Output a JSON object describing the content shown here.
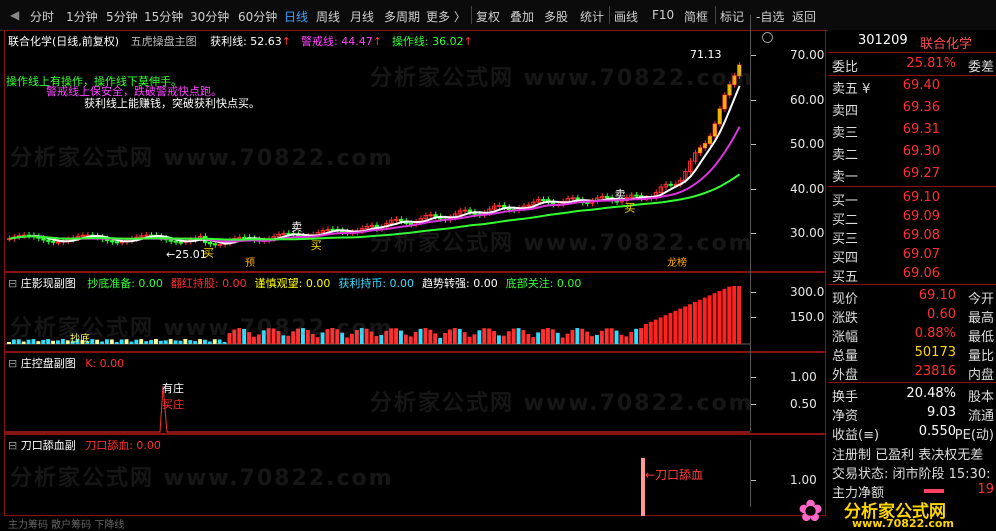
{
  "toolbar": {
    "items": [
      "分时",
      "1分钟",
      "5分钟",
      "15分钟",
      "30分钟",
      "60分钟",
      "日线",
      "周线",
      "月线",
      "多周期",
      "更多 〉",
      "复权",
      "叠加",
      "多股",
      "统计",
      "画线",
      "F10",
      "简框",
      "标记",
      "-自选",
      "返回"
    ],
    "active": "日线"
  },
  "main": {
    "title": "联合化学(日线,前复权)",
    "indicator": "五虎操盘主图",
    "lines": [
      {
        "label": "获利线: 52.63",
        "color": "#ffffff"
      },
      {
        "label": "警戒线: 44.47",
        "color": "#ff44ff"
      },
      {
        "label": "操作线: 36.02",
        "color": "#33ff33"
      }
    ],
    "notes": [
      {
        "text": "操作线上有操作，操作线下莫伸手。",
        "color": "#33ff33"
      },
      {
        "text": "警戒线上保安全，跌破警戒快点跑。",
        "color": "#ff44ff"
      },
      {
        "text": "获利线上能赚钱，突破获利快点买。",
        "color": "#ffffff"
      }
    ],
    "high_label": "71.13",
    "low_label": "25.01",
    "yticks": [
      "70.00",
      "60.00",
      "50.00",
      "40.00",
      "30.00"
    ],
    "marks": {
      "buy": "买",
      "sell": "卖",
      "pre": "预",
      "list": "龙榜"
    }
  },
  "sub1": {
    "title": "庄影现副图",
    "items": [
      {
        "label": "抄底准备: 0.00",
        "color": "#33ff33"
      },
      {
        "label": "翻红持股: 0.00",
        "color": "#ff3030"
      },
      {
        "label": "谨慎观望: 0.00",
        "color": "#ffff00"
      },
      {
        "label": "获利持币: 0.00",
        "color": "#33ddff"
      },
      {
        "label": "趋势转强: 0.00",
        "color": "#ffffff"
      },
      {
        "label": "底部关注: 0.00",
        "color": "#33ff33"
      }
    ],
    "yticks": [
      "300.0",
      "150.0"
    ],
    "bottom_label": "抄底"
  },
  "sub2": {
    "title": "庄控盘副图",
    "k_label": "K: 0.00",
    "yticks": [
      "1.00",
      "0.50"
    ],
    "note1": "有庄",
    "note2": "买庄"
  },
  "sub3": {
    "title": "刀口舔血副",
    "value_label": "刀口舔血: 0.00",
    "yticks": [
      "1.00"
    ],
    "arrow_note": "←刀口舔血"
  },
  "bottom_strip": "主力筹码  散户筹码  下降线",
  "quote": {
    "code": "301209",
    "name": "联合化学",
    "weibi_label": "委比",
    "weibi": "25.81%",
    "weicha_label": "委差",
    "asks": [
      {
        "label": "卖五 ¥",
        "price": "69.40"
      },
      {
        "label": "卖四",
        "price": "69.36"
      },
      {
        "label": "卖三",
        "price": "69.31"
      },
      {
        "label": "卖二",
        "price": "69.30"
      },
      {
        "label": "卖一",
        "price": "69.27"
      }
    ],
    "bids": [
      {
        "label": "买一",
        "price": "69.10"
      },
      {
        "label": "买二",
        "price": "69.09"
      },
      {
        "label": "买三",
        "price": "69.08"
      },
      {
        "label": "买四",
        "price": "69.07"
      },
      {
        "label": "买五",
        "price": "69.06"
      }
    ],
    "stats": [
      {
        "k": "现价",
        "v": "69.10",
        "k2": "今开",
        "c": "red"
      },
      {
        "k": "涨跌",
        "v": "0.60",
        "k2": "最高",
        "c": "red"
      },
      {
        "k": "涨幅",
        "v": "0.88%",
        "k2": "最低",
        "c": "red"
      },
      {
        "k": "总量",
        "v": "50173",
        "k2": "量比",
        "c": "yellow"
      },
      {
        "k": "外盘",
        "v": "23816",
        "k2": "内盘",
        "c": "red"
      }
    ],
    "stats2": [
      {
        "k": "换手",
        "v": "20.48%",
        "k2": "股本"
      },
      {
        "k": "净资",
        "v": "9.03",
        "k2": "流通"
      },
      {
        "k": "收益(≡)",
        "v": "0.550",
        "k2": "PE(动)"
      }
    ],
    "reg": "注册制 已盈利 表决权无差",
    "trade_status": "交易状态: 闭市阶段 15:30:",
    "net_flow": "主力净额",
    "net_flow_val": "19"
  },
  "logo": {
    "cn": "分析家公式网",
    "url": "www.70822.com"
  },
  "watermark": "分析家公式网 www.70822.com",
  "colors": {
    "frame": "#8b1010",
    "up": "#ff3030",
    "down": "#33ff33",
    "accent": "#3fa0ff"
  }
}
